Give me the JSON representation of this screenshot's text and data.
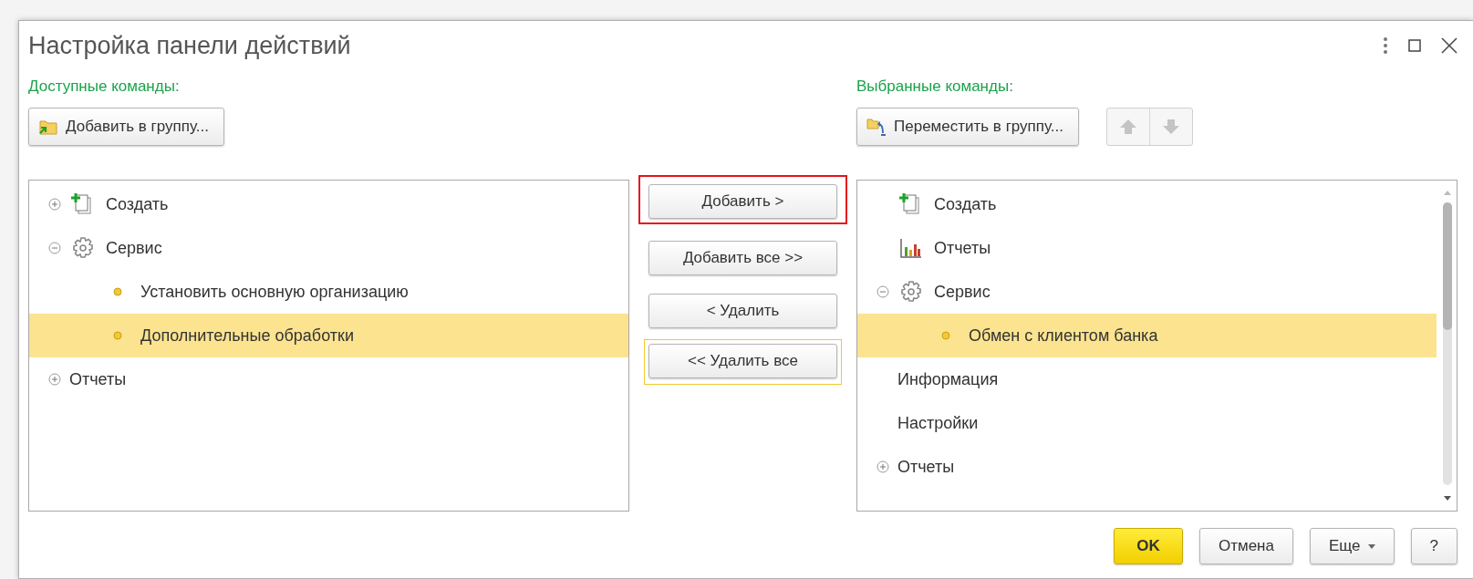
{
  "window": {
    "title": "Настройка панели действий"
  },
  "available": {
    "label": "Доступные команды:",
    "group_button": "Добавить в группу...",
    "tree": [
      {
        "label": "Создать",
        "kind": "create",
        "expanded": false,
        "selected": false
      },
      {
        "label": "Сервис",
        "kind": "gear",
        "expanded": true,
        "selected": false,
        "children": [
          {
            "label": "Установить основную организацию",
            "kind": "bullet",
            "selected": false
          },
          {
            "label": "Дополнительные обработки",
            "kind": "bullet",
            "selected": true
          }
        ]
      },
      {
        "label": "Отчеты",
        "kind": "plain",
        "expanded": false,
        "selected": false
      }
    ]
  },
  "transfer_buttons": [
    {
      "label": "Добавить >",
      "highlighted": true,
      "focused": false
    },
    {
      "label": "Добавить все >>",
      "highlighted": false,
      "focused": false
    },
    {
      "label": "< Удалить",
      "highlighted": false,
      "focused": false
    },
    {
      "label": "<< Удалить все",
      "highlighted": false,
      "focused": true
    }
  ],
  "selected_commands": {
    "label": "Выбранные команды:",
    "group_button": "Переместить в группу...",
    "tree": [
      {
        "label": "Создать",
        "kind": "create",
        "selected": false
      },
      {
        "label": "Отчеты",
        "kind": "chart",
        "selected": false
      },
      {
        "label": "Сервис",
        "kind": "gear",
        "expanded": true,
        "selected": false,
        "children": [
          {
            "label": "Обмен с клиентом банка",
            "kind": "bullet",
            "selected": true
          }
        ]
      },
      {
        "label": "Информация",
        "kind": "plain",
        "selected": false
      },
      {
        "label": "Настройки",
        "kind": "plain",
        "selected": false
      },
      {
        "label": "Отчеты",
        "kind": "plain",
        "expanded": false,
        "selected": false
      }
    ]
  },
  "footer_buttons": [
    {
      "label": "OK",
      "default": true
    },
    {
      "label": "Отмена",
      "default": false
    },
    {
      "label": "Еще",
      "default": false,
      "menu": true
    },
    {
      "label": "?",
      "default": false
    }
  ]
}
